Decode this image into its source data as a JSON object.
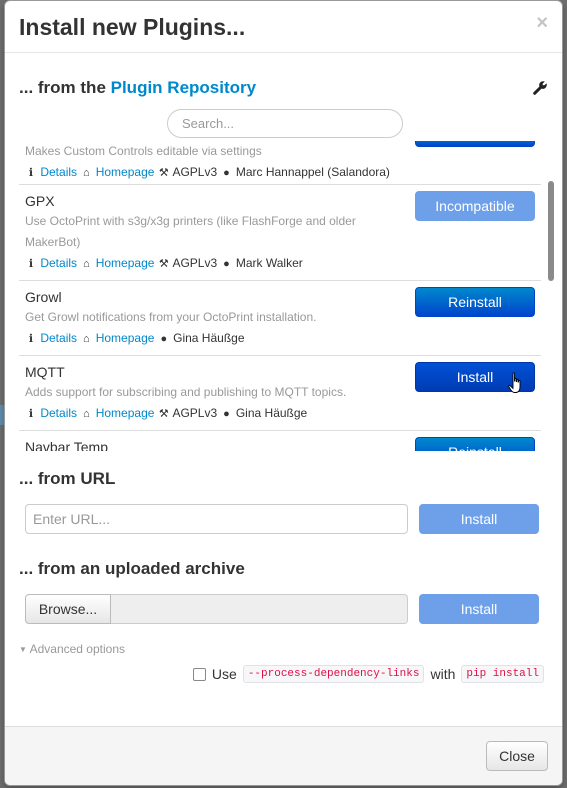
{
  "dialog": {
    "title": "Install new Plugins...",
    "close_glyph": "×"
  },
  "repository": {
    "heading_prefix": "... from the ",
    "heading_link": "Plugin Repository",
    "settings_icon": "wrench-icon",
    "search_placeholder": "Search...",
    "plugins": [
      {
        "name": "",
        "description": "Makes Custom Controls editable via settings",
        "details_label": "Details",
        "homepage_label": "Homepage",
        "license": "AGPLv3",
        "author": "Marc Hannappel (Salandora)",
        "button": ""
      },
      {
        "name": "GPX",
        "description": "Use OctoPrint with s3g/x3g printers (like FlashForge and older MakerBot)",
        "details_label": "Details",
        "homepage_label": "Homepage",
        "license": "AGPLv3",
        "author": "Mark Walker",
        "button": "Incompatible"
      },
      {
        "name": "Growl",
        "description": "Get Growl notifications from your OctoPrint installation.",
        "details_label": "Details",
        "homepage_label": "Homepage",
        "license": "",
        "author": "Gina Häußge",
        "button": "Reinstall"
      },
      {
        "name": "MQTT",
        "description": "Adds support for subscribing and publishing to MQTT topics.",
        "details_label": "Details",
        "homepage_label": "Homepage",
        "license": "AGPLv3",
        "author": "Gina Häußge",
        "button": "Install"
      },
      {
        "name": "Navbar Temp",
        "description": "",
        "details_label": "",
        "homepage_label": "",
        "license": "",
        "author": "",
        "button": "Reinstall"
      }
    ]
  },
  "from_url": {
    "heading": "... from URL",
    "placeholder": "Enter URL...",
    "button": "Install"
  },
  "from_archive": {
    "heading": "... from an uploaded archive",
    "browse_label": "Browse...",
    "button": "Install"
  },
  "advanced": {
    "toggle_label": "Advanced options",
    "use_label": "Use",
    "flag_code": "--process-dependency-links",
    "with_label": "with",
    "command_code": "pip install"
  },
  "footer": {
    "close_label": "Close"
  },
  "colors": {
    "link": "#0088cc",
    "primary_button": "#0044cc",
    "disabled_button": "#6ea0ea"
  }
}
